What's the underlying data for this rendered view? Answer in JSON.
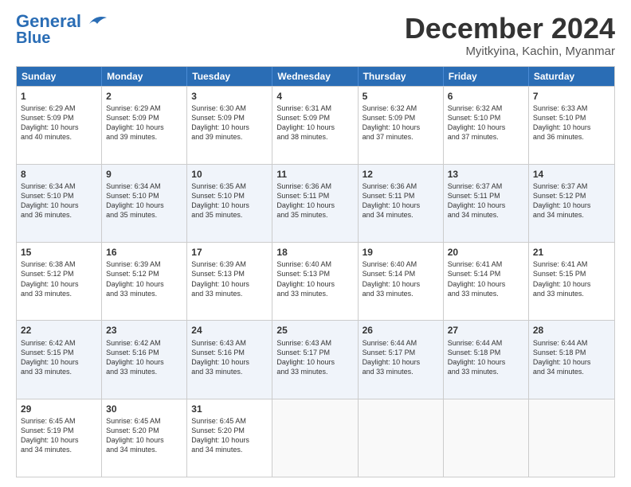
{
  "logo": {
    "line1": "General",
    "line2": "Blue"
  },
  "title": "December 2024",
  "location": "Myitkyina, Kachin, Myanmar",
  "days_of_week": [
    "Sunday",
    "Monday",
    "Tuesday",
    "Wednesday",
    "Thursday",
    "Friday",
    "Saturday"
  ],
  "weeks": [
    [
      {
        "day": "1",
        "text": "Sunrise: 6:29 AM\nSunset: 5:09 PM\nDaylight: 10 hours\nand 40 minutes."
      },
      {
        "day": "2",
        "text": "Sunrise: 6:29 AM\nSunset: 5:09 PM\nDaylight: 10 hours\nand 39 minutes."
      },
      {
        "day": "3",
        "text": "Sunrise: 6:30 AM\nSunset: 5:09 PM\nDaylight: 10 hours\nand 39 minutes."
      },
      {
        "day": "4",
        "text": "Sunrise: 6:31 AM\nSunset: 5:09 PM\nDaylight: 10 hours\nand 38 minutes."
      },
      {
        "day": "5",
        "text": "Sunrise: 6:32 AM\nSunset: 5:09 PM\nDaylight: 10 hours\nand 37 minutes."
      },
      {
        "day": "6",
        "text": "Sunrise: 6:32 AM\nSunset: 5:10 PM\nDaylight: 10 hours\nand 37 minutes."
      },
      {
        "day": "7",
        "text": "Sunrise: 6:33 AM\nSunset: 5:10 PM\nDaylight: 10 hours\nand 36 minutes."
      }
    ],
    [
      {
        "day": "8",
        "text": "Sunrise: 6:34 AM\nSunset: 5:10 PM\nDaylight: 10 hours\nand 36 minutes."
      },
      {
        "day": "9",
        "text": "Sunrise: 6:34 AM\nSunset: 5:10 PM\nDaylight: 10 hours\nand 35 minutes."
      },
      {
        "day": "10",
        "text": "Sunrise: 6:35 AM\nSunset: 5:10 PM\nDaylight: 10 hours\nand 35 minutes."
      },
      {
        "day": "11",
        "text": "Sunrise: 6:36 AM\nSunset: 5:11 PM\nDaylight: 10 hours\nand 35 minutes."
      },
      {
        "day": "12",
        "text": "Sunrise: 6:36 AM\nSunset: 5:11 PM\nDaylight: 10 hours\nand 34 minutes."
      },
      {
        "day": "13",
        "text": "Sunrise: 6:37 AM\nSunset: 5:11 PM\nDaylight: 10 hours\nand 34 minutes."
      },
      {
        "day": "14",
        "text": "Sunrise: 6:37 AM\nSunset: 5:12 PM\nDaylight: 10 hours\nand 34 minutes."
      }
    ],
    [
      {
        "day": "15",
        "text": "Sunrise: 6:38 AM\nSunset: 5:12 PM\nDaylight: 10 hours\nand 33 minutes."
      },
      {
        "day": "16",
        "text": "Sunrise: 6:39 AM\nSunset: 5:12 PM\nDaylight: 10 hours\nand 33 minutes."
      },
      {
        "day": "17",
        "text": "Sunrise: 6:39 AM\nSunset: 5:13 PM\nDaylight: 10 hours\nand 33 minutes."
      },
      {
        "day": "18",
        "text": "Sunrise: 6:40 AM\nSunset: 5:13 PM\nDaylight: 10 hours\nand 33 minutes."
      },
      {
        "day": "19",
        "text": "Sunrise: 6:40 AM\nSunset: 5:14 PM\nDaylight: 10 hours\nand 33 minutes."
      },
      {
        "day": "20",
        "text": "Sunrise: 6:41 AM\nSunset: 5:14 PM\nDaylight: 10 hours\nand 33 minutes."
      },
      {
        "day": "21",
        "text": "Sunrise: 6:41 AM\nSunset: 5:15 PM\nDaylight: 10 hours\nand 33 minutes."
      }
    ],
    [
      {
        "day": "22",
        "text": "Sunrise: 6:42 AM\nSunset: 5:15 PM\nDaylight: 10 hours\nand 33 minutes."
      },
      {
        "day": "23",
        "text": "Sunrise: 6:42 AM\nSunset: 5:16 PM\nDaylight: 10 hours\nand 33 minutes."
      },
      {
        "day": "24",
        "text": "Sunrise: 6:43 AM\nSunset: 5:16 PM\nDaylight: 10 hours\nand 33 minutes."
      },
      {
        "day": "25",
        "text": "Sunrise: 6:43 AM\nSunset: 5:17 PM\nDaylight: 10 hours\nand 33 minutes."
      },
      {
        "day": "26",
        "text": "Sunrise: 6:44 AM\nSunset: 5:17 PM\nDaylight: 10 hours\nand 33 minutes."
      },
      {
        "day": "27",
        "text": "Sunrise: 6:44 AM\nSunset: 5:18 PM\nDaylight: 10 hours\nand 33 minutes."
      },
      {
        "day": "28",
        "text": "Sunrise: 6:44 AM\nSunset: 5:18 PM\nDaylight: 10 hours\nand 34 minutes."
      }
    ],
    [
      {
        "day": "29",
        "text": "Sunrise: 6:45 AM\nSunset: 5:19 PM\nDaylight: 10 hours\nand 34 minutes."
      },
      {
        "day": "30",
        "text": "Sunrise: 6:45 AM\nSunset: 5:20 PM\nDaylight: 10 hours\nand 34 minutes."
      },
      {
        "day": "31",
        "text": "Sunrise: 6:45 AM\nSunset: 5:20 PM\nDaylight: 10 hours\nand 34 minutes."
      },
      {
        "day": "",
        "text": ""
      },
      {
        "day": "",
        "text": ""
      },
      {
        "day": "",
        "text": ""
      },
      {
        "day": "",
        "text": ""
      }
    ]
  ]
}
